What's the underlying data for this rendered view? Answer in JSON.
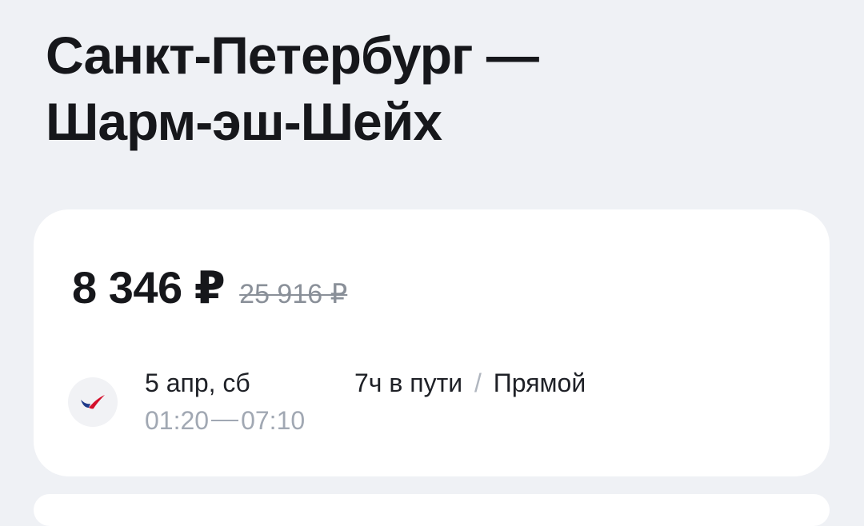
{
  "route": {
    "from": "Санкт-Петербург —",
    "to": "Шарм-эш-Шейх"
  },
  "ticket": {
    "price_current": "8 346 ₽",
    "price_old": "25 916 ₽",
    "airline_icon": "airline-logo-icon",
    "date": "5 апр, сб",
    "depart_time": "01:20",
    "arrive_time": "07:10",
    "duration": "7ч в пути",
    "separator": "/",
    "stops": "Прямой"
  },
  "colors": {
    "background": "#eff1f5",
    "card": "#ffffff",
    "text_primary": "#16171b",
    "text_muted": "#a1a8b3",
    "logo_red": "#d4102b",
    "logo_blue": "#1f3a8a"
  }
}
